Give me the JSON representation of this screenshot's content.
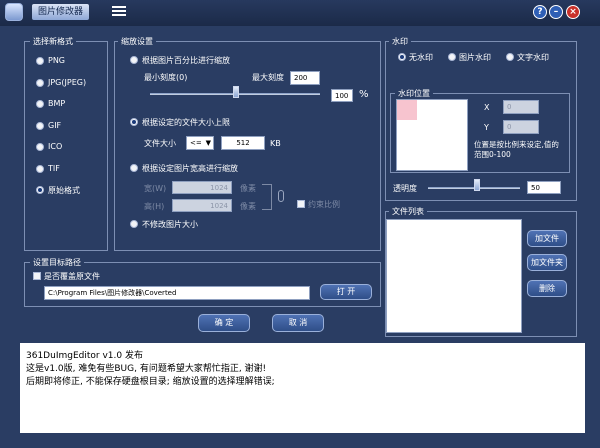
{
  "title": "图片修改器",
  "format": {
    "section": "选择新格式",
    "options": [
      "PNG",
      "JPG(JPEG)",
      "BMP",
      "GIF",
      "ICO",
      "TIF",
      "原始格式"
    ],
    "selected_index": 6
  },
  "scale": {
    "section": "缩放设置",
    "option_percent": "根据图片百分比进行缩放",
    "min_label": "最小刻度(0)",
    "max_label": "最大刻度",
    "max_value": "200",
    "percent_value": "100",
    "percent_unit": "%",
    "option_size": "根据设定的文件大小上限",
    "filesize_label": "文件大小",
    "filesize_op": "<=",
    "filesize_value": "512",
    "filesize_unit": "KB",
    "option_wh": "根据设定图片宽高进行缩放",
    "width_label": "宽(W)",
    "width_value": "1024",
    "height_label": "高(H)",
    "height_value": "1024",
    "pixel_unit": "像素",
    "keep_ratio": "约束比例",
    "option_none": "不修改图片大小",
    "selected_option": "size"
  },
  "target": {
    "section": "设置目标路径",
    "overwrite": "是否覆盖原文件",
    "path": "C:\\Program Files\\图片修改器\\Coverted",
    "open_btn": "打 开"
  },
  "ok_btn": "确 定",
  "cancel_btn": "取 消",
  "watermark": {
    "section": "水印",
    "options": [
      "无水印",
      "图片水印",
      "文字水印"
    ],
    "selected_index": 0,
    "position_section": "水印位置",
    "x_label": "X",
    "x_value": "0",
    "y_label": "Y",
    "y_value": "0",
    "note": "位置是按比例来设定,值的范围0-100",
    "transparency_label": "透明度",
    "transparency_value": "50"
  },
  "filelist": {
    "section": "文件列表",
    "add_file": "加文件",
    "add_folder": "加文件夹",
    "delete": "删除"
  },
  "log": [
    "361DuImgEditor v1.0 发布",
    "这是v1.0版, 难免有些BUG, 有问题希望大家帮忙指正, 谢谢!",
    "后期即将修正, 不能保存硬盘根目录; 缩放设置的选择理解错误;"
  ]
}
